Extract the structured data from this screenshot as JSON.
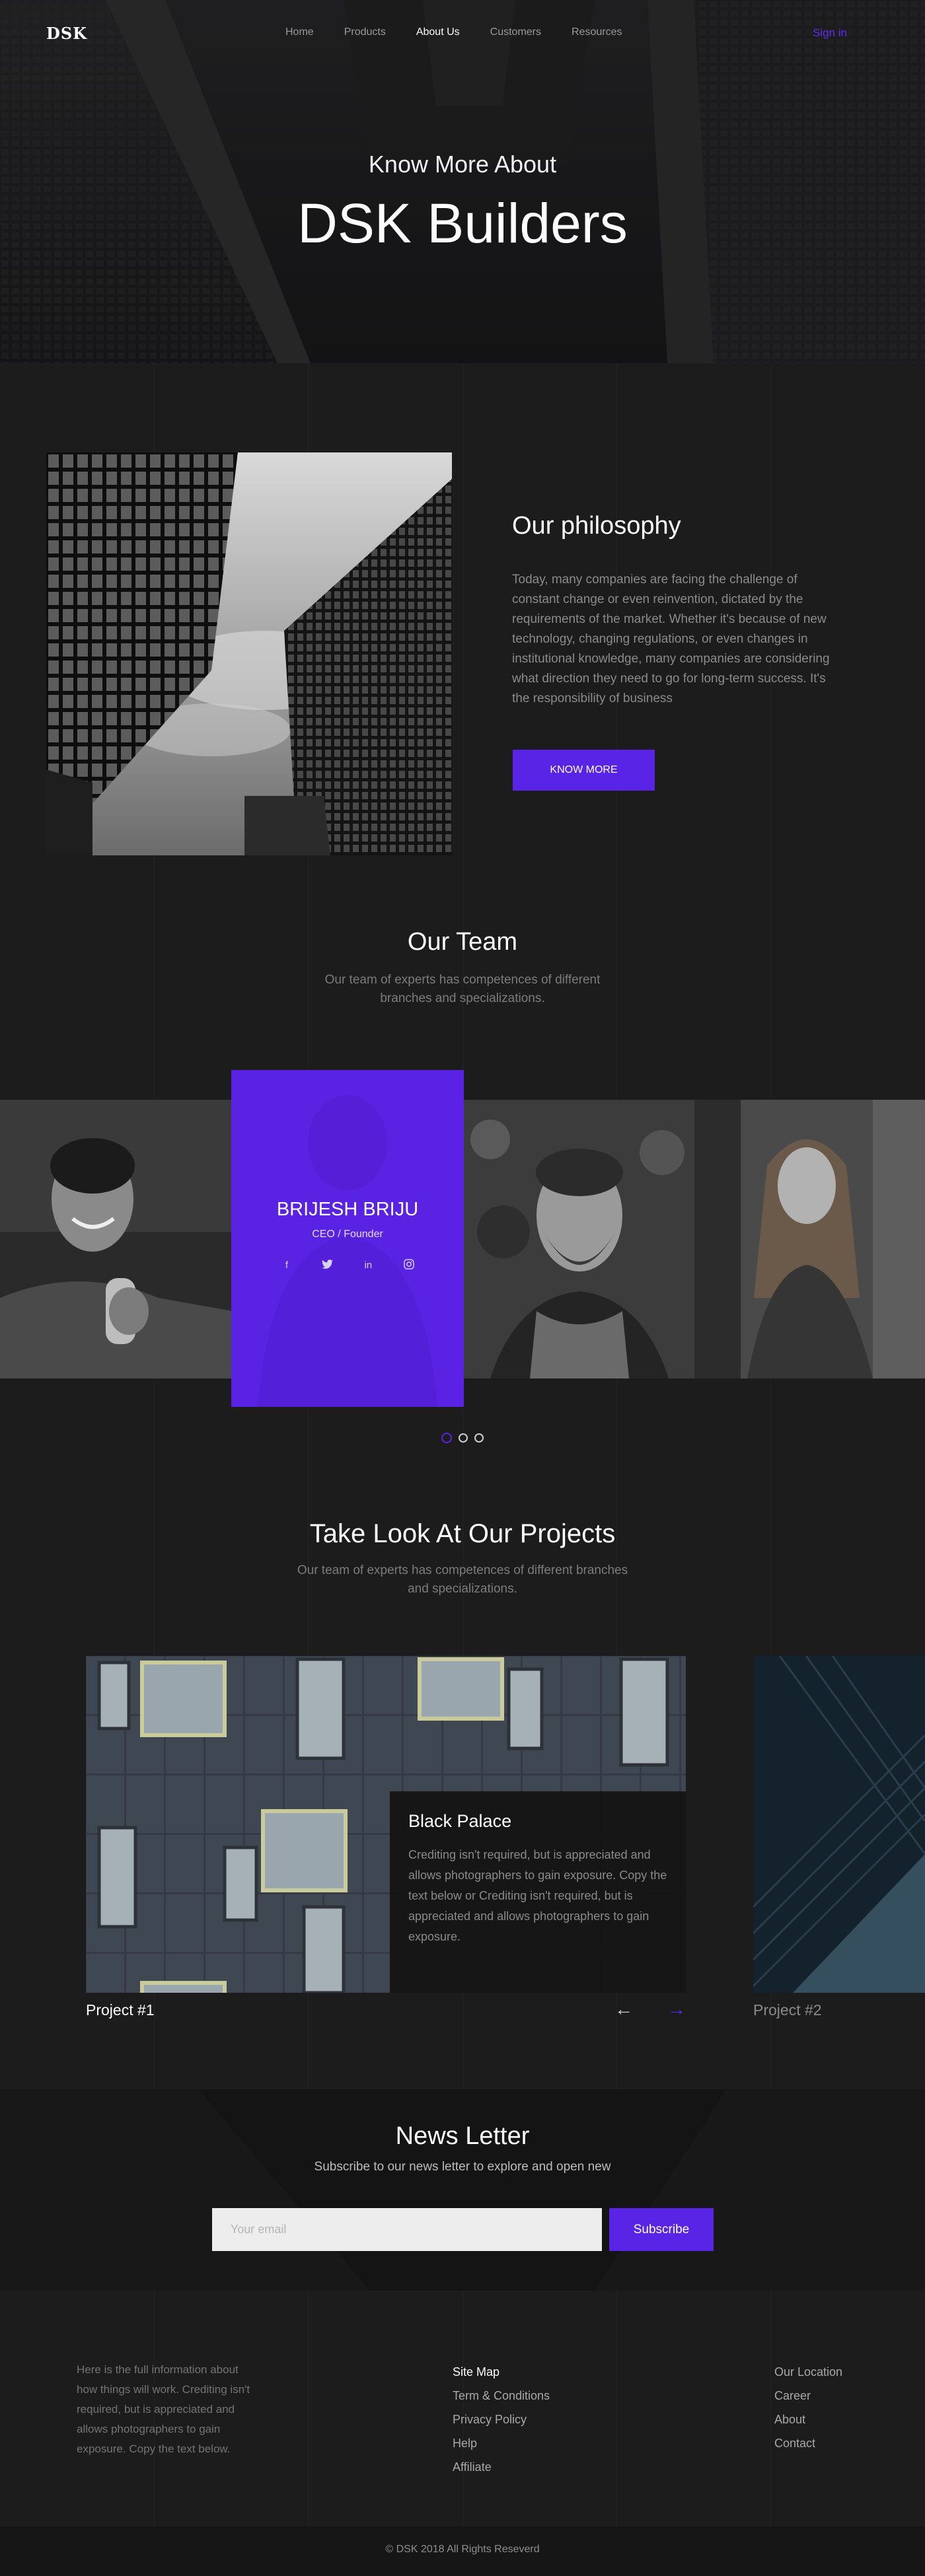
{
  "nav": {
    "logo": "DSK",
    "links": [
      "Home",
      "Products",
      "About Us",
      "Customers",
      "Resources"
    ],
    "active_link": "About Us",
    "signin": "Sign in"
  },
  "hero": {
    "subtitle": "Know More About",
    "title": "DSK Builders"
  },
  "philosophy": {
    "title": "Our philosophy",
    "text": "Today, many companies are facing the challenge of constant change or even reinvention, dictated by the requirements of the market. Whether it's because of new technology, changing regulations, or even changes in institutional knowledge, many companies are considering what direction they need to go for long-term success. It's the responsibility of business",
    "button": "KNOW MORE"
  },
  "team": {
    "title": "Our Team",
    "subtitle_line1": "Our team of experts has competences of different",
    "subtitle_line2": "branches and specializations.",
    "featured": {
      "name": "BRIJESH BRIJU",
      "role": "CEO / Founder",
      "socials": [
        "facebook-icon",
        "twitter-icon",
        "linkedin-icon",
        "instagram-icon"
      ]
    },
    "slides": 3,
    "active_slide": 1
  },
  "projects": {
    "title": "Take Look At Our Projects",
    "subtitle_line1": "Our team of experts has competences of different branches",
    "subtitle_line2": "and specializations.",
    "items": [
      {
        "caption": "Project #1",
        "name": "Black Palace",
        "description": "Crediting isn't required, but is appreciated and allows photographers to gain exposure. Copy the text below or Crediting isn't required, but is appreciated and allows photographers to gain exposure."
      },
      {
        "caption": "Project #2"
      }
    ],
    "prev_arrow": "←",
    "next_arrow": "→"
  },
  "newsletter": {
    "title": "News Letter",
    "subtitle": "Subscribe to our news letter to explore and open new",
    "input_placeholder": "Your email",
    "button": "Subscribe"
  },
  "footer": {
    "about": "Here is the full information about how things will work. Crediting isn't required, but is appreciated and allows photographers to gain exposure. Copy the text below.",
    "col1": [
      "Site Map",
      "Term & Conditions",
      "Privacy Policy",
      "Help",
      "Affiliate"
    ],
    "col2": [
      "Our Location",
      "Career",
      "About",
      "Contact"
    ],
    "copyright": "© DSK 2018 All Rights Reseverd"
  },
  "colors": {
    "accent": "#5a24e6",
    "background": "#1c1c1d",
    "newsletter_bg": "#141415"
  }
}
